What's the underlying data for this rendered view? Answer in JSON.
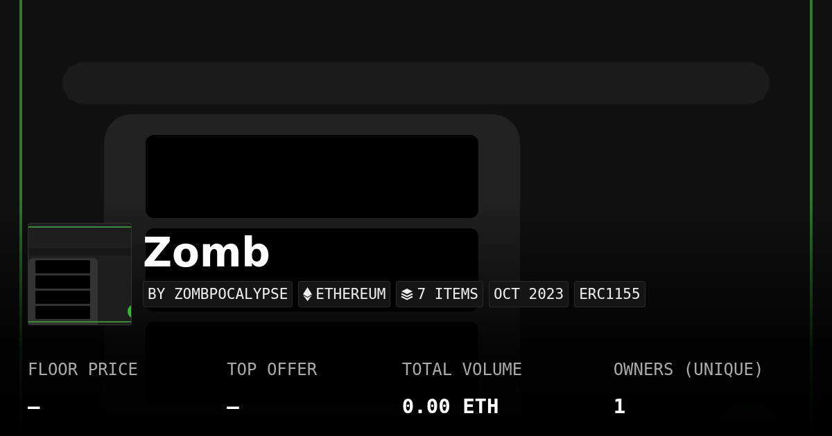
{
  "collection": {
    "name": "Zomb",
    "tags": [
      {
        "kind": "text",
        "label": "BY ZOMBPOCALYPSE"
      },
      {
        "kind": "chain",
        "label": "ETHEREUM"
      },
      {
        "kind": "items",
        "label": "7 ITEMS"
      },
      {
        "kind": "text",
        "label": "OCT 2023"
      },
      {
        "kind": "text",
        "label": "ERC1155"
      }
    ]
  },
  "stats": [
    {
      "label": "FLOOR PRICE",
      "value": "–"
    },
    {
      "label": "TOP OFFER",
      "value": "–"
    },
    {
      "label": "TOTAL VOLUME",
      "value": "0.00 ETH"
    },
    {
      "label": "OWNERS (UNIQUE)",
      "value": "1"
    }
  ]
}
